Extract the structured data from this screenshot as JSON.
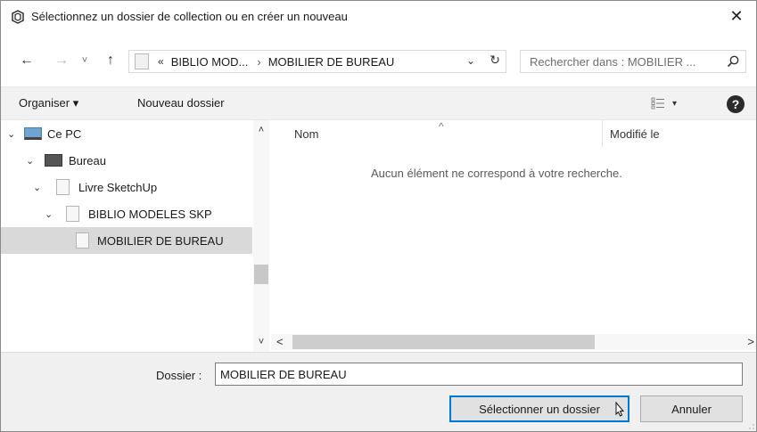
{
  "window": {
    "title": "Sélectionnez un dossier de collection ou en créer un nouveau",
    "close_glyph": "✕",
    "app_icon": "sketchup-icon"
  },
  "navigation": {
    "back_glyph": "←",
    "forward_glyph": "→",
    "recent_glyph": "˅",
    "up_glyph": "↑",
    "address": {
      "overflow_chevron": "«",
      "segments": [
        "BIBLIO MOD...",
        "MOBILIER DE BUREAU"
      ],
      "separator": "›",
      "dropdown_glyph": "⌄",
      "refresh_glyph": "↻"
    },
    "search": {
      "placeholder": "Rechercher dans : MOBILIER ..."
    }
  },
  "toolbar": {
    "organize_label": "Organiser ▾",
    "new_folder_label": "Nouveau dossier",
    "view_caret": "▾",
    "help_glyph": "?"
  },
  "tree": {
    "items": [
      {
        "label": "Ce PC",
        "expanded": true,
        "icon": "computer-icon"
      },
      {
        "label": "Bureau",
        "expanded": true,
        "icon": "desktop-icon"
      },
      {
        "label": "Livre SketchUp",
        "expanded": true,
        "icon": "folder-icon"
      },
      {
        "label": "BIBLIO MODELES SKP",
        "expanded": true,
        "icon": "folder-icon"
      },
      {
        "label": "MOBILIER DE BUREAU",
        "selected": true,
        "icon": "folder-icon"
      }
    ],
    "expand_glyph": "⌄",
    "scroll_up_glyph": "˄",
    "scroll_down_glyph": "˅"
  },
  "content": {
    "columns": [
      "Nom",
      "Modifié le"
    ],
    "sort_caret": "^",
    "empty_message": "Aucun élément ne correspond à votre recherche.",
    "scroll_left_glyph": "<",
    "scroll_right_glyph": ">"
  },
  "footer": {
    "folder_label": "Dossier :",
    "folder_value": "MOBILIER DE BUREAU",
    "select_button": "Sélectionner un dossier",
    "cancel_button": "Annuler"
  }
}
